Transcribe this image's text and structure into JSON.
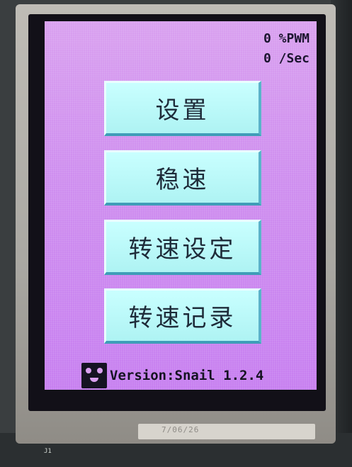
{
  "status": {
    "pwm": "0 %PWM",
    "speed": "0 /Sec"
  },
  "menu": [
    {
      "label": "设置"
    },
    {
      "label": "稳速"
    },
    {
      "label": "转速设定"
    },
    {
      "label": "转速记录"
    }
  ],
  "footer": {
    "icon": "snail-face-icon",
    "version": "Version:Snail 1.2.4"
  },
  "device": {
    "ribbon_text": "7/06/26",
    "pcb_label": "J1"
  },
  "colors": {
    "screen_bg": "#d9a0ef",
    "button_face": "#c9ffff",
    "button_shadow": "#3f9db8",
    "text": "#1e2b39"
  }
}
